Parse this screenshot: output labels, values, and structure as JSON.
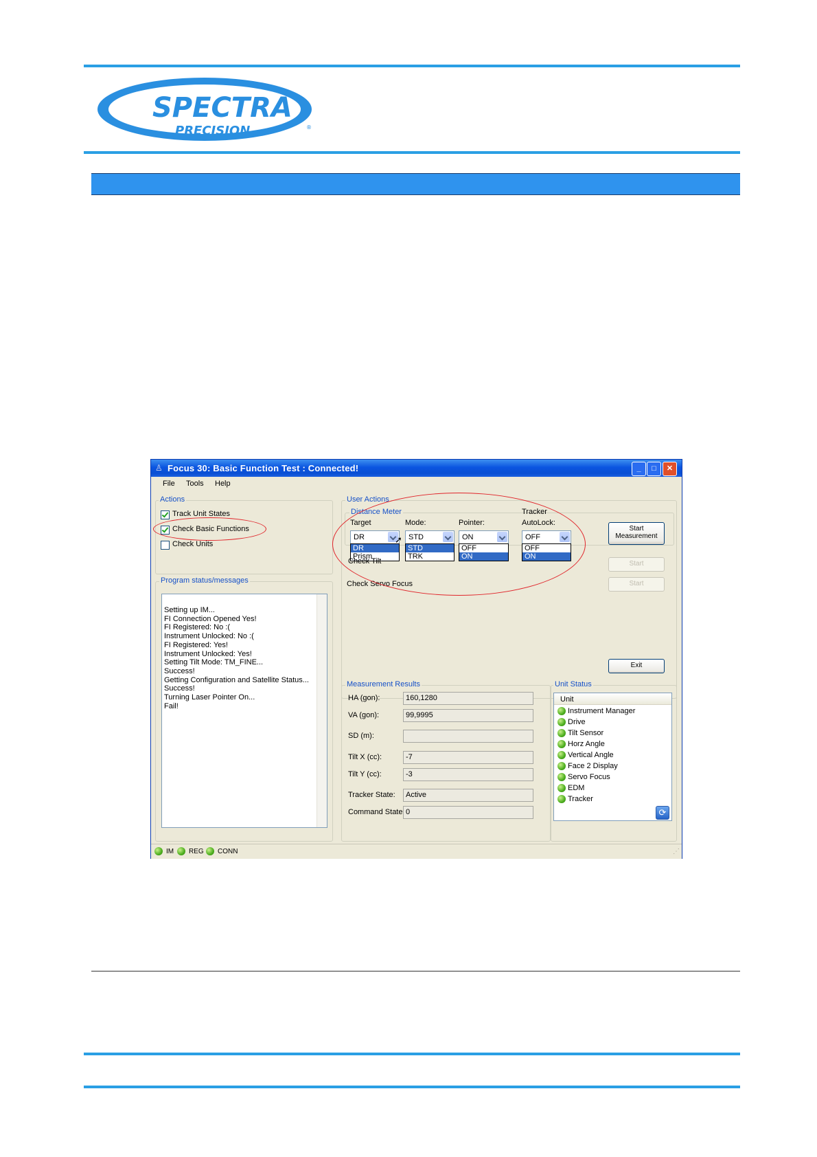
{
  "logo": {
    "line1": "SPECTRA",
    "line2": "PRECISION",
    "mark": "®"
  },
  "window": {
    "title": "Focus 30: Basic Function Test : Connected!",
    "menu": [
      "File",
      "Tools",
      "Help"
    ],
    "actions": {
      "label": "Actions",
      "items": [
        {
          "label": "Track Unit States",
          "checked": true
        },
        {
          "label": "Check Basic Functions",
          "checked": true
        },
        {
          "label": "Check Units",
          "checked": false
        }
      ]
    },
    "program_status": {
      "label": "Program status/messages",
      "messages": [
        "Setting up IM...",
        "FI Connection Opened Yes!",
        "FI Registered: No :(",
        "Instrument Unlocked: No :(",
        "FI Registered: Yes!",
        "Instrument Unlocked: Yes!",
        "Setting Tilt Mode: TM_FINE...",
        "Success!",
        "Getting Configuration and Satellite Status...",
        "Success!",
        "Turning Laser Pointer On...",
        "Fail!"
      ]
    },
    "user_actions": {
      "label": "User Actions",
      "distance_meter_label": "Distance Meter",
      "tracker_label": "Tracker",
      "target": {
        "label": "Target",
        "value": "DR",
        "options": [
          "DR",
          "Prism"
        ]
      },
      "mode": {
        "label": "Mode:",
        "value": "STD",
        "options": [
          "STD",
          "TRK"
        ]
      },
      "pointer": {
        "label": "Pointer:",
        "value": "ON",
        "options": [
          "OFF",
          "ON"
        ]
      },
      "autolock": {
        "label": "AutoLock:",
        "value": "OFF",
        "options": [
          "OFF",
          "ON"
        ]
      },
      "start_measurement_line1": "Start",
      "start_measurement_line2": "Measurement",
      "check_tilt": "Check Tilt",
      "check_servo_focus": "Check Servo Focus",
      "start_label": "Start",
      "exit_label": "Exit"
    },
    "measurement_results": {
      "label": "Measurement Results",
      "rows": [
        {
          "label": "HA (gon):",
          "value": "160,1280"
        },
        {
          "label": "VA (gon):",
          "value": "99,9995"
        },
        {
          "label": "SD (m):",
          "value": ""
        },
        {
          "label": "Tilt X (cc):",
          "value": "-7"
        },
        {
          "label": "Tilt Y (cc):",
          "value": "-3"
        },
        {
          "label": "Tracker State:",
          "value": "Active"
        },
        {
          "label": "Command State:",
          "value": "0"
        }
      ]
    },
    "unit_status": {
      "label": "Unit Status",
      "header": "Unit",
      "units": [
        "Instrument Manager",
        "Drive",
        "Tilt Sensor",
        "Horz Angle",
        "Vertical Angle",
        "Face 2 Display",
        "Servo Focus",
        "EDM",
        "Tracker"
      ],
      "status_color": "#4cae1e"
    },
    "statusbar": [
      "IM",
      "REG",
      "CONN"
    ]
  },
  "colors": {
    "accent_blue": "#2a9fe4",
    "header_bar": "#2f93ee",
    "highlight_ring": "#e0242a"
  }
}
